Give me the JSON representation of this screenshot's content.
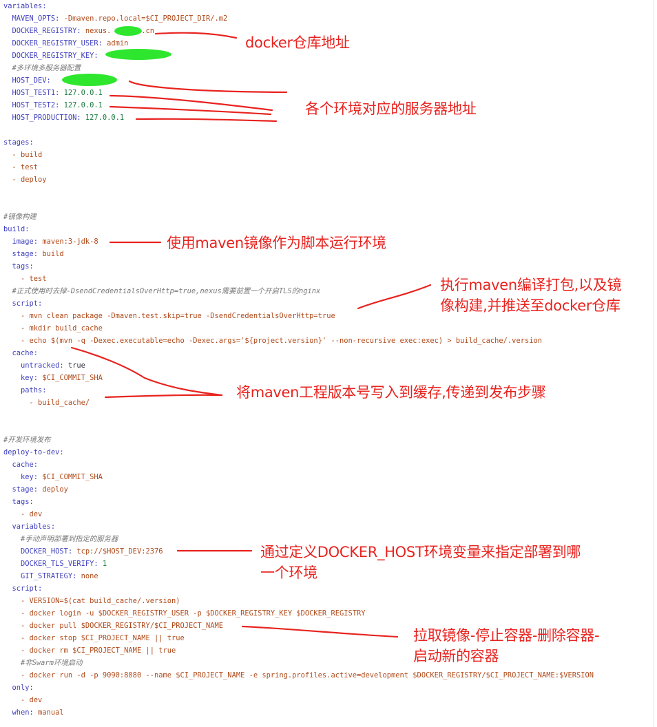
{
  "lines": [
    {
      "segs": [
        {
          "t": "variables:",
          "c": "key"
        }
      ]
    },
    {
      "segs": [
        {
          "t": "  MAVEN_OPTS: ",
          "c": "key"
        },
        {
          "t": "-Dmaven.repo.local=$CI_PROJECT_DIR/.m2",
          "c": "val"
        }
      ]
    },
    {
      "segs": [
        {
          "t": "  DOCKER_REGISTRY: ",
          "c": "key"
        },
        {
          "t": "nexus.       .cn",
          "c": "val"
        }
      ]
    },
    {
      "segs": [
        {
          "t": "  DOCKER_REGISTRY_USER: ",
          "c": "key"
        },
        {
          "t": "admin",
          "c": "val"
        }
      ]
    },
    {
      "segs": [
        {
          "t": "  DOCKER_REGISTRY_KEY: ",
          "c": "key"
        },
        {
          "t": "",
          "c": "val"
        }
      ]
    },
    {
      "segs": [
        {
          "t": "  #多环境多服务器配置",
          "c": "cmt"
        }
      ]
    },
    {
      "segs": [
        {
          "t": "  HOST_DEV: ",
          "c": "key"
        },
        {
          "t": "",
          "c": "val"
        }
      ]
    },
    {
      "segs": [
        {
          "t": "  HOST_TEST1: ",
          "c": "key"
        },
        {
          "t": "127.0.0.1",
          "c": "num"
        }
      ]
    },
    {
      "segs": [
        {
          "t": "  HOST_TEST2: ",
          "c": "key"
        },
        {
          "t": "127.0.0.1",
          "c": "num"
        }
      ]
    },
    {
      "segs": [
        {
          "t": "  HOST_PRODUCTION: ",
          "c": "key"
        },
        {
          "t": "127.0.0.1",
          "c": "num"
        }
      ]
    },
    {
      "segs": []
    },
    {
      "segs": [
        {
          "t": "stages:",
          "c": "key"
        }
      ]
    },
    {
      "segs": [
        {
          "t": "  - ",
          "c": "dash"
        },
        {
          "t": "build",
          "c": "val"
        }
      ]
    },
    {
      "segs": [
        {
          "t": "  - ",
          "c": "dash"
        },
        {
          "t": "test",
          "c": "val"
        }
      ]
    },
    {
      "segs": [
        {
          "t": "  - ",
          "c": "dash"
        },
        {
          "t": "deploy",
          "c": "val"
        }
      ]
    },
    {
      "segs": []
    },
    {
      "segs": []
    },
    {
      "segs": [
        {
          "t": "#镜像构建",
          "c": "cmt"
        }
      ]
    },
    {
      "segs": [
        {
          "t": "build:",
          "c": "key"
        }
      ]
    },
    {
      "segs": [
        {
          "t": "  image: ",
          "c": "key"
        },
        {
          "t": "maven:3-jdk-8",
          "c": "val"
        }
      ]
    },
    {
      "segs": [
        {
          "t": "  stage: ",
          "c": "key"
        },
        {
          "t": "build",
          "c": "val"
        }
      ]
    },
    {
      "segs": [
        {
          "t": "  tags:",
          "c": "key"
        }
      ]
    },
    {
      "segs": [
        {
          "t": "    - ",
          "c": "dash"
        },
        {
          "t": "test",
          "c": "val"
        }
      ]
    },
    {
      "segs": [
        {
          "t": "  #正式使用时去掉-DsendCredentialsOverHttp=true,nexus需要前置一个开启TLS的nginx",
          "c": "cmt"
        }
      ]
    },
    {
      "segs": [
        {
          "t": "  script:",
          "c": "key"
        }
      ]
    },
    {
      "segs": [
        {
          "t": "    - ",
          "c": "dash"
        },
        {
          "t": "mvn clean package -Dmaven.test.skip=true -DsendCredentialsOverHttp=true",
          "c": "val"
        }
      ]
    },
    {
      "segs": [
        {
          "t": "    - ",
          "c": "dash"
        },
        {
          "t": "mkdir build_cache",
          "c": "val"
        }
      ]
    },
    {
      "segs": [
        {
          "t": "    - ",
          "c": "dash"
        },
        {
          "t": "echo $(mvn -q -Dexec.executable=echo -Dexec.args='${project.version}' --non-recursive exec:exec) > build_cache/.version",
          "c": "val"
        }
      ]
    },
    {
      "segs": [
        {
          "t": "  cache:",
          "c": "key"
        }
      ]
    },
    {
      "segs": [
        {
          "t": "    untracked: ",
          "c": "key"
        },
        {
          "t": "true",
          "c": "plain"
        }
      ]
    },
    {
      "segs": [
        {
          "t": "    key: ",
          "c": "key"
        },
        {
          "t": "$CI_COMMIT_SHA",
          "c": "val"
        }
      ]
    },
    {
      "segs": [
        {
          "t": "    paths:",
          "c": "key"
        }
      ]
    },
    {
      "segs": [
        {
          "t": "      - ",
          "c": "dash"
        },
        {
          "t": "build_cache/",
          "c": "val"
        }
      ]
    },
    {
      "segs": []
    },
    {
      "segs": []
    },
    {
      "segs": [
        {
          "t": "#开发环境发布",
          "c": "cmt"
        }
      ]
    },
    {
      "segs": [
        {
          "t": "deploy-to-dev:",
          "c": "key"
        }
      ]
    },
    {
      "segs": [
        {
          "t": "  cache:",
          "c": "key"
        }
      ]
    },
    {
      "segs": [
        {
          "t": "    key: ",
          "c": "key"
        },
        {
          "t": "$CI_COMMIT_SHA",
          "c": "val"
        }
      ]
    },
    {
      "segs": [
        {
          "t": "  stage: ",
          "c": "key"
        },
        {
          "t": "deploy",
          "c": "val"
        }
      ]
    },
    {
      "segs": [
        {
          "t": "  tags:",
          "c": "key"
        }
      ]
    },
    {
      "segs": [
        {
          "t": "    - ",
          "c": "dash"
        },
        {
          "t": "dev",
          "c": "val"
        }
      ]
    },
    {
      "segs": [
        {
          "t": "  variables:",
          "c": "key"
        }
      ]
    },
    {
      "segs": [
        {
          "t": "    #手动声明部署到指定的服务器",
          "c": "cmt"
        }
      ]
    },
    {
      "segs": [
        {
          "t": "    DOCKER_HOST: ",
          "c": "key"
        },
        {
          "t": "tcp://$HOST_DEV:2376",
          "c": "val"
        }
      ]
    },
    {
      "segs": [
        {
          "t": "    DOCKER_TLS_VERIFY: ",
          "c": "key"
        },
        {
          "t": "1",
          "c": "num"
        }
      ]
    },
    {
      "segs": [
        {
          "t": "    GIT_STRATEGY: ",
          "c": "key"
        },
        {
          "t": "none",
          "c": "val"
        }
      ]
    },
    {
      "segs": [
        {
          "t": "  script:",
          "c": "key"
        }
      ]
    },
    {
      "segs": [
        {
          "t": "    - ",
          "c": "dash"
        },
        {
          "t": "VERSION=$(cat build_cache/.version)",
          "c": "val"
        }
      ]
    },
    {
      "segs": [
        {
          "t": "    - ",
          "c": "dash"
        },
        {
          "t": "docker login -u $DOCKER_REGISTRY_USER -p $DOCKER_REGISTRY_KEY $DOCKER_REGISTRY",
          "c": "val"
        }
      ]
    },
    {
      "segs": [
        {
          "t": "    - ",
          "c": "dash"
        },
        {
          "t": "docker pull $DOCKER_REGISTRY/$CI_PROJECT_NAME",
          "c": "val"
        }
      ]
    },
    {
      "segs": [
        {
          "t": "    - ",
          "c": "dash"
        },
        {
          "t": "docker stop $CI_PROJECT_NAME || true",
          "c": "val"
        }
      ]
    },
    {
      "segs": [
        {
          "t": "    - ",
          "c": "dash"
        },
        {
          "t": "docker rm $CI_PROJECT_NAME || true",
          "c": "val"
        }
      ]
    },
    {
      "segs": [
        {
          "t": "    #非Swarm环境启动",
          "c": "cmt"
        }
      ]
    },
    {
      "segs": [
        {
          "t": "    - ",
          "c": "dash"
        },
        {
          "t": "docker run -d -p 9090:8080 --name $CI_PROJECT_NAME -e spring.profiles.active=development $DOCKER_REGISTRY/$CI_PROJECT_NAME:$VERSION",
          "c": "val"
        }
      ]
    },
    {
      "segs": [
        {
          "t": "  only:",
          "c": "key"
        }
      ]
    },
    {
      "segs": [
        {
          "t": "    - ",
          "c": "dash"
        },
        {
          "t": "dev",
          "c": "val"
        }
      ]
    },
    {
      "segs": [
        {
          "t": "  when: ",
          "c": "key"
        },
        {
          "t": "manual",
          "c": "val"
        }
      ]
    }
  ],
  "annotations": {
    "registry_note": "docker仓库地址",
    "hosts_note": "各个环境对应的服务器地址",
    "image_note": "使用maven镜像作为脚本运行环境",
    "script_note_1": "执行maven编译打包,以及镜",
    "script_note_2": "像构建,并推送至docker仓库",
    "cache_note": "将maven工程版本号写入到缓存,传递到发布步骤",
    "docker_host_note_1": "通过定义DOCKER_HOST环境变量来指定部署到哪",
    "docker_host_note_2": "一个环境",
    "pull_note_1": "拉取镜像-停止容器-删除容器-",
    "pull_note_2": "启动新的容器"
  },
  "colors": {
    "annotation": "#e8231f",
    "redaction": "#2ee62e",
    "key": "#3f3fbf",
    "value": "#b04a1a",
    "comment": "#7a7a7a"
  }
}
